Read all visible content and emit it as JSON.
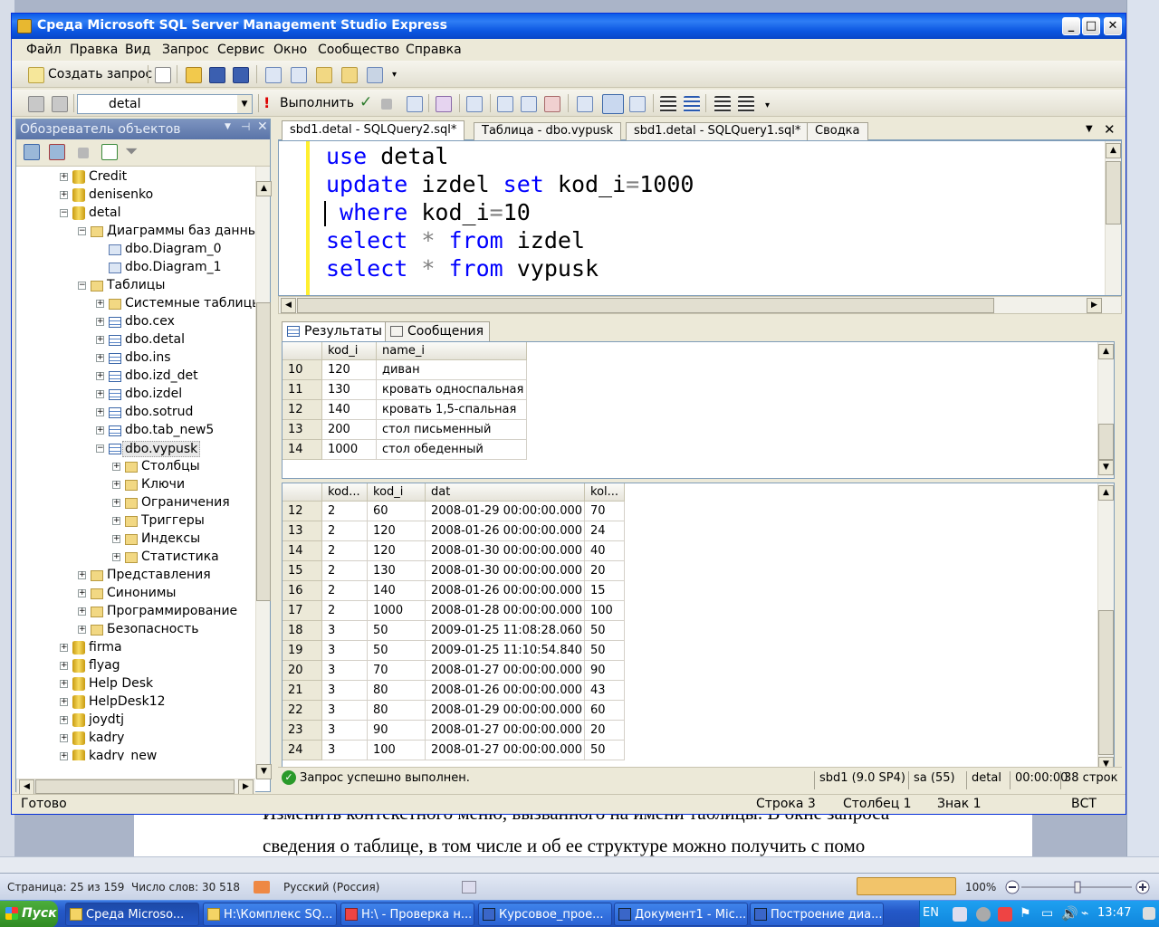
{
  "window": {
    "title": "Среда Microsoft SQL Server Management Studio Express"
  },
  "menu": [
    "Файл",
    "Правка",
    "Вид",
    "Запрос",
    "Сервис",
    "Окно",
    "Сообщество",
    "Справка"
  ],
  "toolbar1": {
    "new_query": "Создать запрос"
  },
  "toolbar2": {
    "database": "detal",
    "execute": "Выполнить"
  },
  "object_explorer": {
    "title": "Обозреватель объектов",
    "tree": [
      {
        "label": "Credit",
        "type": "db",
        "level": 0,
        "exp": "+"
      },
      {
        "label": "denisenko",
        "type": "db",
        "level": 0,
        "exp": "+"
      },
      {
        "label": "detal",
        "type": "db",
        "level": 0,
        "exp": "-"
      },
      {
        "label": "Диаграммы баз данных",
        "type": "fold",
        "level": 1,
        "exp": "-"
      },
      {
        "label": "dbo.Diagram_0",
        "type": "dia",
        "level": 2,
        "exp": ""
      },
      {
        "label": "dbo.Diagram_1",
        "type": "dia",
        "level": 2,
        "exp": ""
      },
      {
        "label": "Таблицы",
        "type": "fold",
        "level": 1,
        "exp": "-"
      },
      {
        "label": "Системные таблицы",
        "type": "fold",
        "level": 2,
        "exp": "+"
      },
      {
        "label": "dbo.cex",
        "type": "tbl",
        "level": 2,
        "exp": "+"
      },
      {
        "label": "dbo.detal",
        "type": "tbl",
        "level": 2,
        "exp": "+"
      },
      {
        "label": "dbo.ins",
        "type": "tbl",
        "level": 2,
        "exp": "+"
      },
      {
        "label": "dbo.izd_det",
        "type": "tbl",
        "level": 2,
        "exp": "+"
      },
      {
        "label": "dbo.izdel",
        "type": "tbl",
        "level": 2,
        "exp": "+"
      },
      {
        "label": "dbo.sotrud",
        "type": "tbl",
        "level": 2,
        "exp": "+"
      },
      {
        "label": "dbo.tab_new5",
        "type": "tbl",
        "level": 2,
        "exp": "+"
      },
      {
        "label": "dbo.vypusk",
        "type": "tbl",
        "level": 2,
        "exp": "-",
        "selected": true
      },
      {
        "label": "Столбцы",
        "type": "fold",
        "level": 3,
        "exp": "+"
      },
      {
        "label": "Ключи",
        "type": "fold",
        "level": 3,
        "exp": "+"
      },
      {
        "label": "Ограничения",
        "type": "fold",
        "level": 3,
        "exp": "+"
      },
      {
        "label": "Триггеры",
        "type": "fold",
        "level": 3,
        "exp": "+"
      },
      {
        "label": "Индексы",
        "type": "fold",
        "level": 3,
        "exp": "+"
      },
      {
        "label": "Статистика",
        "type": "fold",
        "level": 3,
        "exp": "+"
      },
      {
        "label": "Представления",
        "type": "fold",
        "level": 1,
        "exp": "+"
      },
      {
        "label": "Синонимы",
        "type": "fold",
        "level": 1,
        "exp": "+"
      },
      {
        "label": "Программирование",
        "type": "fold",
        "level": 1,
        "exp": "+"
      },
      {
        "label": "Безопасность",
        "type": "fold",
        "level": 1,
        "exp": "+"
      },
      {
        "label": "firma",
        "type": "db",
        "level": 0,
        "exp": "+"
      },
      {
        "label": "flyag",
        "type": "db",
        "level": 0,
        "exp": "+"
      },
      {
        "label": "Help Desk",
        "type": "db",
        "level": 0,
        "exp": "+"
      },
      {
        "label": "HelpDesk12",
        "type": "db",
        "level": 0,
        "exp": "+"
      },
      {
        "label": "joydtj",
        "type": "db",
        "level": 0,
        "exp": "+"
      },
      {
        "label": "kadry",
        "type": "db",
        "level": 0,
        "exp": "+"
      },
      {
        "label": "kadry_new",
        "type": "db",
        "level": 0,
        "exp": "+"
      }
    ]
  },
  "doc_tabs": [
    "sbd1.detal - SQLQuery2.sql*",
    "Таблица - dbo.vypusk",
    "sbd1.detal - SQLQuery1.sql*",
    "Сводка"
  ],
  "editor_lines": [
    [
      {
        "t": "use ",
        "c": "kw"
      },
      {
        "t": "detal",
        "c": ""
      }
    ],
    [
      {
        "t": "update ",
        "c": "kw"
      },
      {
        "t": "izdel ",
        "c": ""
      },
      {
        "t": "set ",
        "c": "kw"
      },
      {
        "t": "kod_i",
        "c": ""
      },
      {
        "t": "=",
        "c": "op"
      },
      {
        "t": "1000",
        "c": ""
      }
    ],
    [
      {
        "t": " where ",
        "c": "kw"
      },
      {
        "t": "kod_i",
        "c": ""
      },
      {
        "t": "=",
        "c": "op"
      },
      {
        "t": "10",
        "c": ""
      }
    ],
    [
      {
        "t": "select ",
        "c": "kw"
      },
      {
        "t": "* ",
        "c": "op"
      },
      {
        "t": "from ",
        "c": "kw"
      },
      {
        "t": "izdel",
        "c": ""
      }
    ],
    [
      {
        "t": "select ",
        "c": "kw"
      },
      {
        "t": "* ",
        "c": "op"
      },
      {
        "t": "from ",
        "c": "kw"
      },
      {
        "t": "vypusk",
        "c": ""
      }
    ]
  ],
  "results": {
    "tab_results": "Результаты",
    "tab_messages": "Сообщения",
    "grid1": {
      "columns": [
        "kod_i",
        "name_i"
      ],
      "rows": [
        [
          "10",
          "120",
          "диван"
        ],
        [
          "11",
          "130",
          "кровать односпальная"
        ],
        [
          "12",
          "140",
          "кровать 1,5-спальная"
        ],
        [
          "13",
          "200",
          "стол письменный"
        ],
        [
          "14",
          "1000",
          "стол обеденный"
        ]
      ]
    },
    "grid2": {
      "columns": [
        "kod...",
        "kod_i",
        "dat",
        "kol..."
      ],
      "rows": [
        [
          "12",
          "2",
          "60",
          "2008-01-29 00:00:00.000",
          "70"
        ],
        [
          "13",
          "2",
          "120",
          "2008-01-26 00:00:00.000",
          "24"
        ],
        [
          "14",
          "2",
          "120",
          "2008-01-30 00:00:00.000",
          "40"
        ],
        [
          "15",
          "2",
          "130",
          "2008-01-30 00:00:00.000",
          "20"
        ],
        [
          "16",
          "2",
          "140",
          "2008-01-26 00:00:00.000",
          "15"
        ],
        [
          "17",
          "2",
          "1000",
          "2008-01-28 00:00:00.000",
          "100"
        ],
        [
          "18",
          "3",
          "50",
          "2009-01-25 11:08:28.060",
          "50"
        ],
        [
          "19",
          "3",
          "50",
          "2009-01-25 11:10:54.840",
          "50"
        ],
        [
          "20",
          "3",
          "70",
          "2008-01-27 00:00:00.000",
          "90"
        ],
        [
          "21",
          "3",
          "80",
          "2008-01-26 00:00:00.000",
          "43"
        ],
        [
          "22",
          "3",
          "80",
          "2008-01-29 00:00:00.000",
          "60"
        ],
        [
          "23",
          "3",
          "90",
          "2008-01-27 00:00:00.000",
          "20"
        ],
        [
          "24",
          "3",
          "100",
          "2008-01-27 00:00:00.000",
          "50"
        ]
      ]
    }
  },
  "query_status": {
    "message": "Запрос успешно выполнен.",
    "server": "sbd1 (9.0 SP4)",
    "user": "sa (55)",
    "db": "detal",
    "time": "00:00:00",
    "rows": "38 строк"
  },
  "status_bar": {
    "ready": "Готово",
    "line": "Строка 3",
    "col": "Столбец 1",
    "char": "Знак 1",
    "mode": "ВСТ"
  },
  "word": {
    "line1": "Изменить контекстного меню, вызванного на имени таблицы. В окне запроса",
    "line2": "сведения о таблице, в том числе и  об ее структуре можно получить с помо",
    "page": "Страница: 25 из 159",
    "words": "Число слов: 30 518",
    "lang": "Русский (Россия)",
    "zoom": "100%"
  },
  "taskbar": {
    "start": "Пуск",
    "tasks": [
      "Среда Microso...",
      "H:\\Комплекс SQ...",
      "H:\\ - Проверка н...",
      "Курсовое_прое...",
      "Документ1 - Mic...",
      "Построение диа..."
    ],
    "lang": "EN",
    "clock": "13:47"
  }
}
